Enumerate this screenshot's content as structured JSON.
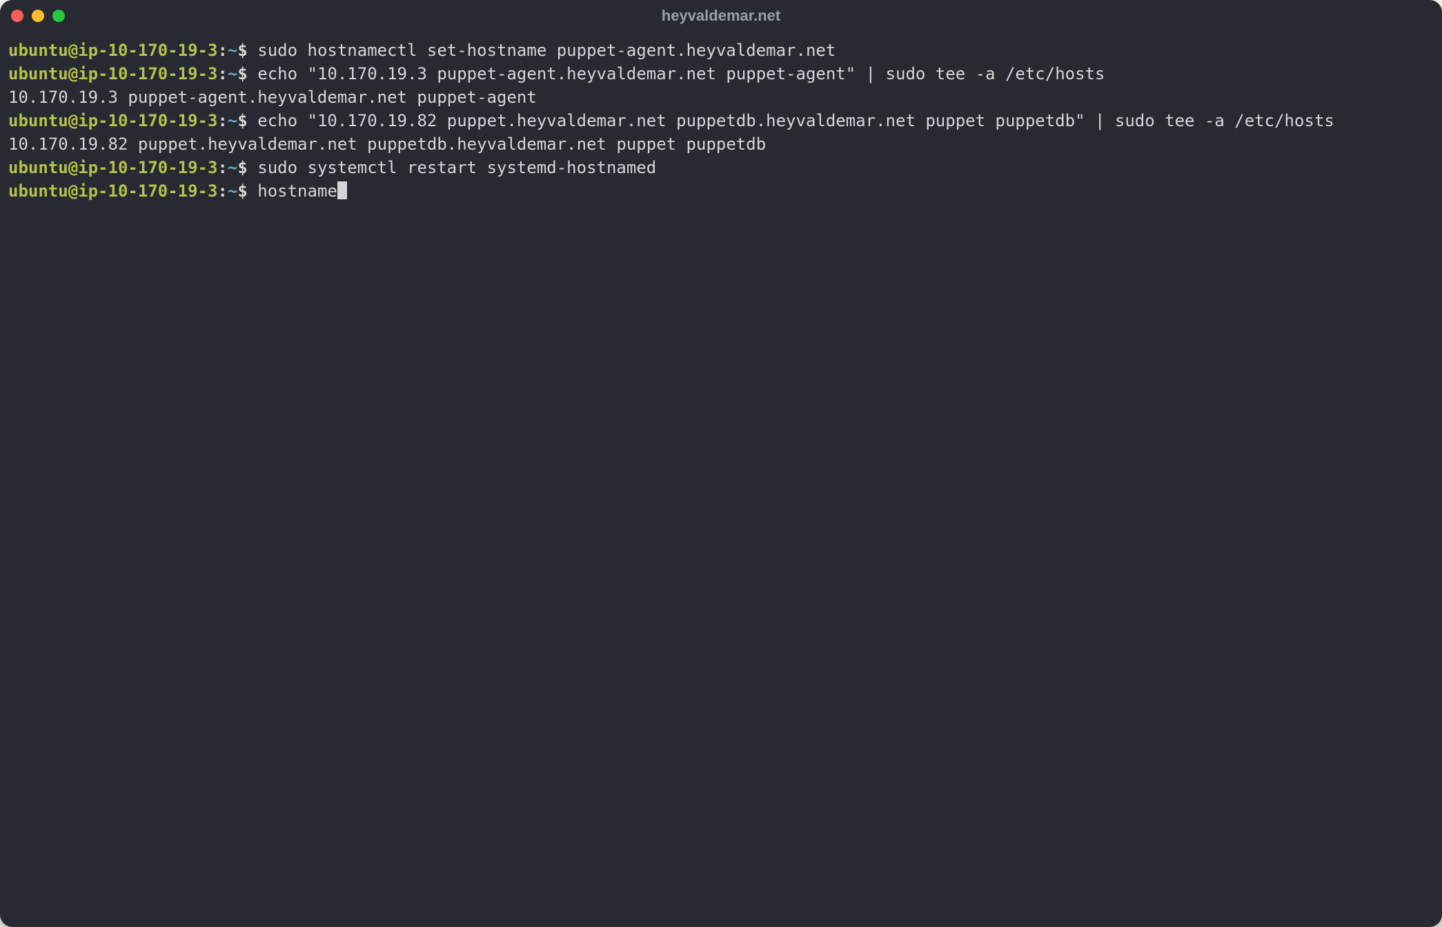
{
  "window": {
    "title": "heyvaldemar.net"
  },
  "prompt": {
    "user_host": "ubuntu@ip-10-170-19-3",
    "colon": ":",
    "path": "~",
    "dollar": "$"
  },
  "lines": {
    "l1_cmd": "sudo hostnamectl set-hostname puppet-agent.heyvaldemar.net",
    "l2_cmd": "echo \"10.170.19.3 puppet-agent.heyvaldemar.net puppet-agent\" | sudo tee -a /etc/hosts",
    "l3_out": "10.170.19.3 puppet-agent.heyvaldemar.net puppet-agent",
    "l4_cmd": "echo \"10.170.19.82 puppet.heyvaldemar.net puppetdb.heyvaldemar.net puppet puppetdb\" | sudo tee -a /etc/hosts",
    "l5_out": "10.170.19.82 puppet.heyvaldemar.net puppetdb.heyvaldemar.net puppet puppetdb",
    "l6_cmd": "sudo systemctl restart systemd-hostnamed",
    "l7_cmd": "hostname"
  },
  "colors": {
    "bg": "#272a31",
    "user": "#b6c24b",
    "path": "#6fa8c7",
    "text": "#d6d6d6"
  }
}
